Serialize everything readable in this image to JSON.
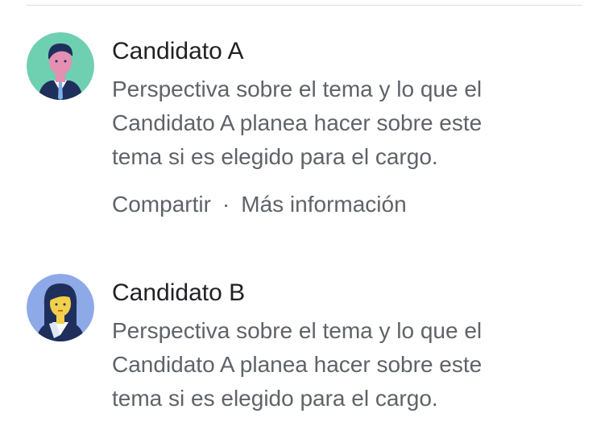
{
  "candidates": [
    {
      "name": "Candidato A",
      "description_lines": [
        "Perspectiva sobre el tema y lo que el",
        "Candidato A planea hacer sobre este",
        "tema si es elegido para el cargo."
      ],
      "actions": {
        "share": "Compartir",
        "separator": "·",
        "more_info": "Más información"
      },
      "avatar_bg": "#6fcfb1"
    },
    {
      "name": "Candidato B",
      "description_lines": [
        "Perspectiva sobre el tema y lo que el",
        "Candidato A planea hacer sobre este",
        "tema si es elegido para el cargo."
      ],
      "avatar_bg": "#8ea9e8"
    }
  ]
}
